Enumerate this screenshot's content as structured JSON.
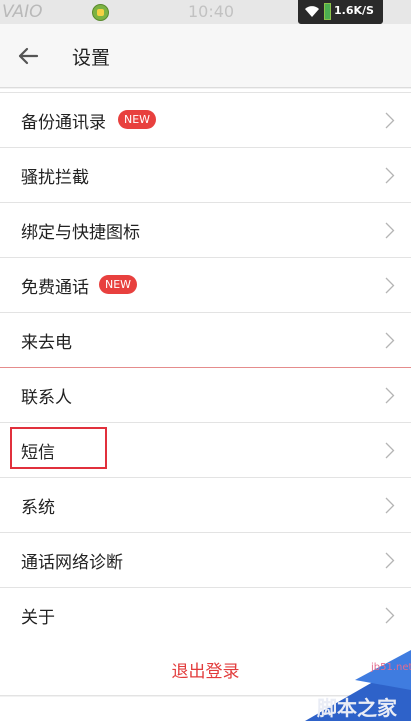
{
  "status_bar": {
    "brand": "VAIO",
    "time": "10:40",
    "net_speed": "1.6K/S"
  },
  "header": {
    "title": "设置"
  },
  "settings": {
    "items": [
      {
        "label": "备份通讯录",
        "badge": "NEW"
      },
      {
        "label": "骚扰拦截"
      },
      {
        "label": "绑定与快捷图标"
      },
      {
        "label": "免费通话",
        "badge": "NEW"
      },
      {
        "label": "来去电"
      },
      {
        "label": "联系人"
      },
      {
        "label": "短信"
      },
      {
        "label": "系统"
      },
      {
        "label": "通话网络诊断"
      },
      {
        "label": "关于"
      }
    ],
    "logout_label": "退出登录"
  },
  "watermark": {
    "url": "jb51.net",
    "text": "脚本之家"
  },
  "colors": {
    "accent_red": "#e23c3c",
    "badge_red": "#e8403e",
    "header_bg": "#f7f7f7"
  }
}
